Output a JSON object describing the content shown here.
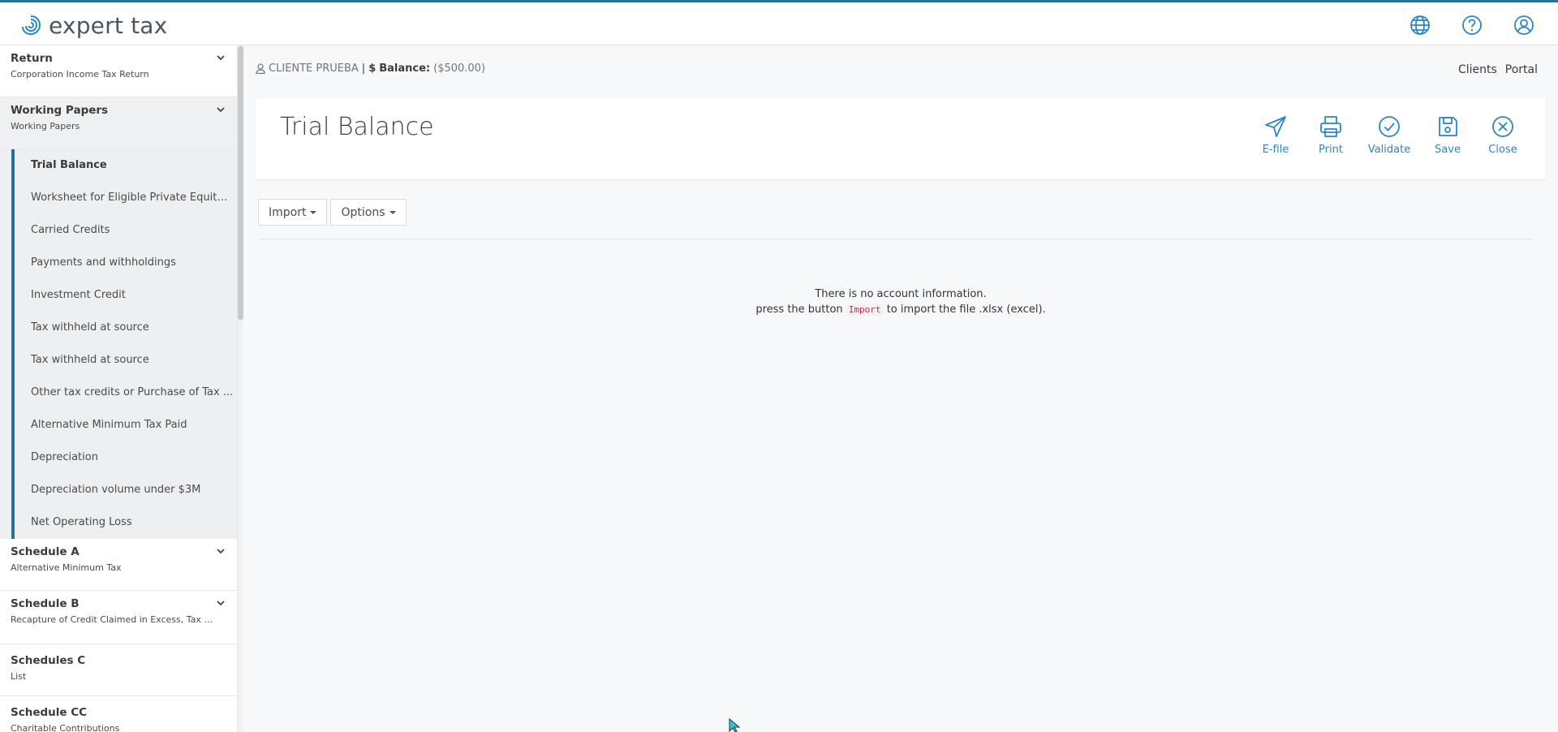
{
  "app": {
    "logo_text": "expert tax"
  },
  "sidebar": {
    "return": {
      "title": "Return",
      "subtitle": "Corporation Income Tax Return"
    },
    "working_papers": {
      "title": "Working Papers",
      "subtitle": "Working Papers",
      "items": [
        "Trial Balance",
        "Worksheet for Eligible Private Equity I...",
        "Carried Credits",
        "Payments and withholdings",
        "Investment Credit",
        "Tax withheld at source",
        "Tax withheld at source",
        "Other tax credits or Purchase of Tax ...",
        "Alternative Minimum Tax Paid",
        "Depreciation",
        "Depreciation volume under $3M",
        "Net Operating Loss"
      ]
    },
    "schedule_a": {
      "title": "Schedule A",
      "subtitle": "Alternative Minimum Tax"
    },
    "schedule_b": {
      "title": "Schedule B",
      "subtitle": "Recapture of Credit Claimed in Excess, Tax Cre..."
    },
    "schedules_c": {
      "title": "Schedules C",
      "subtitle": "List"
    },
    "schedule_cc": {
      "title": "Schedule CC",
      "subtitle": "Charitable Contributions"
    }
  },
  "breadcrumb": {
    "client": "CLIENTE PRUEBA",
    "separator": "|",
    "balance_label": "Balance:",
    "balance_value": "($500.00)"
  },
  "nav": {
    "clients": "Clients",
    "portal": "Portal"
  },
  "page": {
    "title": "Trial Balance",
    "actions": {
      "efile": "E-file",
      "print": "Print",
      "validate": "Validate",
      "save": "Save",
      "close": "Close"
    }
  },
  "toolbar": {
    "import": "Import",
    "options": "Options"
  },
  "empty_state": {
    "line1": "There is no account information.",
    "line2_prefix": "press the button",
    "line2_code": "Import",
    "line2_suffix": "to import the file .xlsx (excel)."
  },
  "colors": {
    "accent": "#2a86c4",
    "brand": "#2a6f97",
    "code": "#c7254e"
  }
}
